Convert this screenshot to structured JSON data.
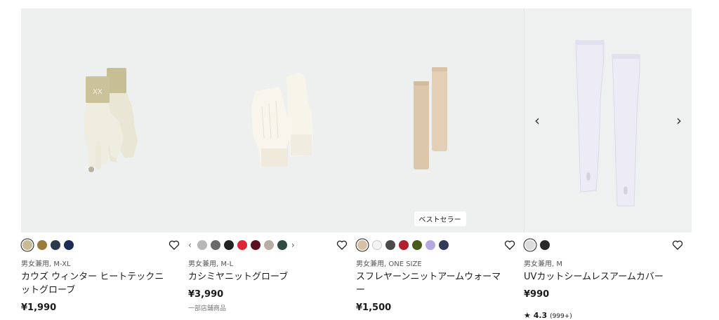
{
  "products": [
    {
      "meta": "男女兼用, M-XL",
      "name": "カウズ ウィンター ヒートテックニットグローブ",
      "price": "¥1,990",
      "image": "beige-knit-gloves-with-logo-cuff",
      "swatches": [
        "#c9bb93",
        "#9a7b3a",
        "#2b3a4a",
        "#1e2d55"
      ]
    },
    {
      "meta": "男女兼用, M-L",
      "name": "カシミヤニットグローブ",
      "price": "¥3,990",
      "note": "一部店舗商品",
      "image": "cream-cashmere-knit-gloves",
      "swatches": [
        "#b8b8b8",
        "#6a6a6a",
        "#222222",
        "#e0243a",
        "#5a1020",
        "#b9aea6",
        "#2f4a3e"
      ]
    },
    {
      "meta": "男女兼用, ONE SIZE",
      "name": "スフレヤーンニットアームウォーマー",
      "price": "¥1,500",
      "badge": "ベストセラー",
      "image": "tan-arm-warmers",
      "swatches": [
        "#d7c0a5",
        "#f3f3f3",
        "#4a4a4a",
        "#b0202f",
        "#4a5a1c",
        "#b8a8e0",
        "#333a5a"
      ]
    },
    {
      "meta": "男女兼用, M",
      "name": "UVカットシームレスアームカバー",
      "price": "¥990",
      "rating": "4.3",
      "rating_count": "(999+)",
      "image": "lavender-uv-arm-covers",
      "swatches": [
        "#dcdcdc",
        "#2a2a2a"
      ]
    }
  ],
  "carousel": {
    "prev": "‹",
    "next": "›"
  },
  "swatch_nav": {
    "prev": "‹",
    "next": "›"
  },
  "star": "★"
}
